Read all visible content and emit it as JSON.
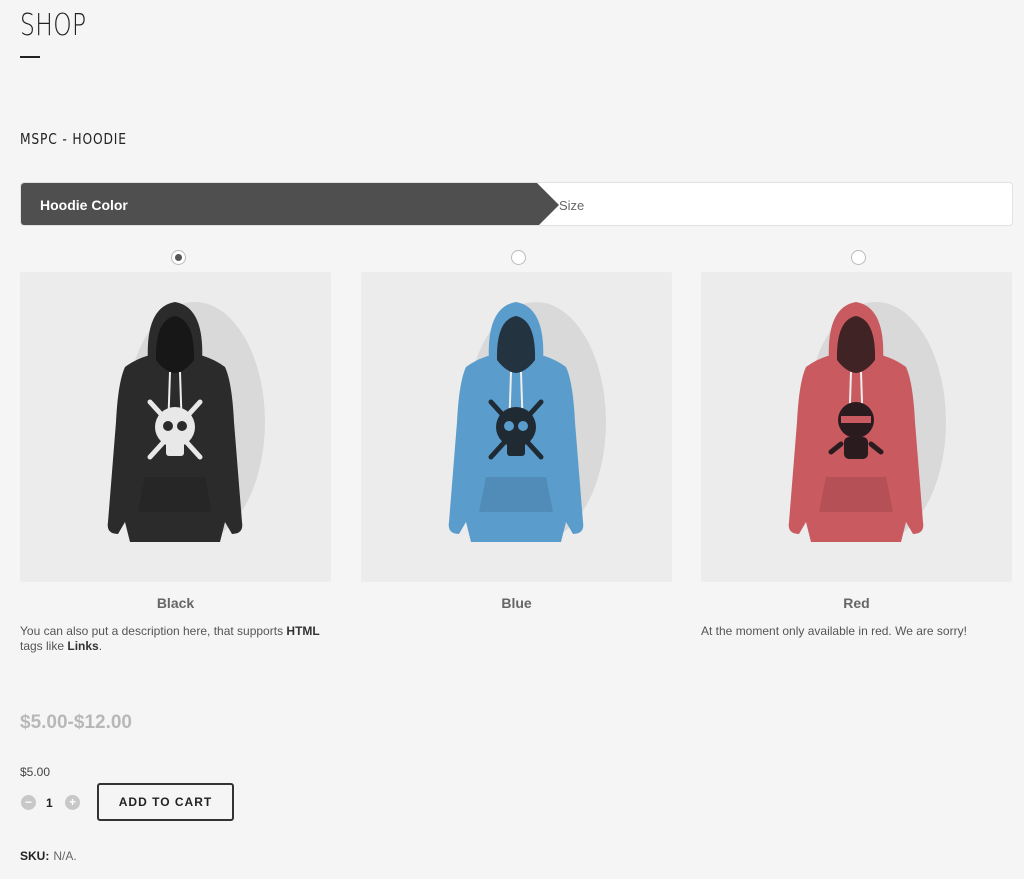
{
  "page": {
    "title": "SHOP"
  },
  "product": {
    "name": "MSPC - HOODIE",
    "steps": [
      {
        "label": "Hoodie Color",
        "active": true
      },
      {
        "label": "Size",
        "active": false
      }
    ],
    "options": [
      {
        "label": "Black",
        "selected": true,
        "hoodie_color": "#2b2b2b",
        "graphic_color": "#e8e8e8",
        "graphic": "skull-crossbones-icon",
        "description": {
          "prefix": "You can also put a description here, that supports ",
          "bold1": "HTML",
          "middle": " tags like ",
          "bold2": "Links",
          "suffix": "."
        }
      },
      {
        "label": "Blue",
        "selected": false,
        "hoodie_color": "#5a9ccc",
        "graphic_color": "#1f2a33",
        "graphic": "skull-crossbones-icon"
      },
      {
        "label": "Red",
        "selected": false,
        "hoodie_color": "#c95a60",
        "graphic_color": "#2a1c1e",
        "graphic": "ninja-character-icon",
        "description": {
          "text": "At the moment only available in red. We are sorry!"
        }
      }
    ],
    "price_range": "$5.00-$12.00",
    "unit_price": "$5.00",
    "quantity": "1",
    "add_to_cart_label": "ADD TO CART",
    "sku": {
      "label": "SKU:",
      "value": "N/A."
    }
  }
}
